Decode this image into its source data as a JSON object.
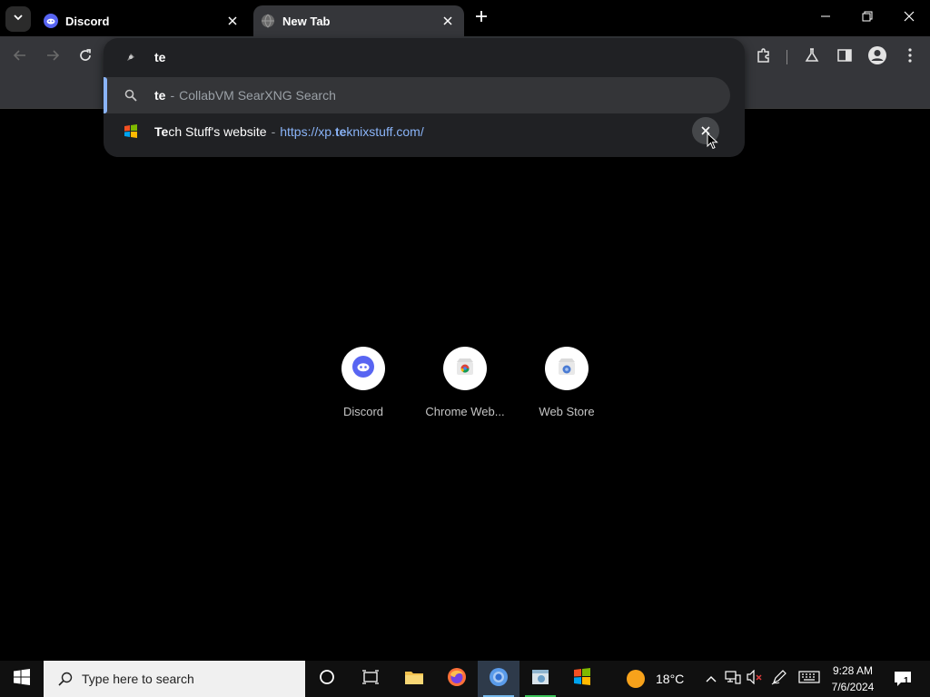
{
  "tabs": [
    {
      "title": "Discord",
      "icon": "discord-icon"
    },
    {
      "title": "New Tab",
      "icon": "globe-icon",
      "active": true
    }
  ],
  "omnibox": {
    "input_value": "te",
    "suggestions": [
      {
        "type": "search",
        "query": "te",
        "separator": "-",
        "engine_text": "CollabVM SearXNG Search",
        "icon": "search-icon"
      },
      {
        "type": "history",
        "title_match": "Te",
        "title_rest": "ch Stuff's website",
        "separator": "-",
        "url_prefix": "https://xp.",
        "url_match": "te",
        "url_rest": "knixstuff.com/",
        "icon": "windows-xp-icon",
        "remove_icon": "close-icon"
      }
    ]
  },
  "shortcuts": [
    {
      "label": "Discord",
      "icon": "discord-icon"
    },
    {
      "label": "Chrome Web...",
      "icon": "chrome-web-store-icon"
    },
    {
      "label": "Web Store",
      "icon": "web-store-icon"
    }
  ],
  "taskbar": {
    "search_placeholder": "Type here to search",
    "weather": "18°C",
    "time": "9:28 AM",
    "date": "7/6/2024",
    "notification_count": "1"
  },
  "colors": {
    "accent": "#8ab4f8",
    "toolbar_bg": "#35363a",
    "omnibox_bg": "#202124",
    "selection_bar": "#8ab4f8",
    "taskbar_bg": "#101010"
  }
}
